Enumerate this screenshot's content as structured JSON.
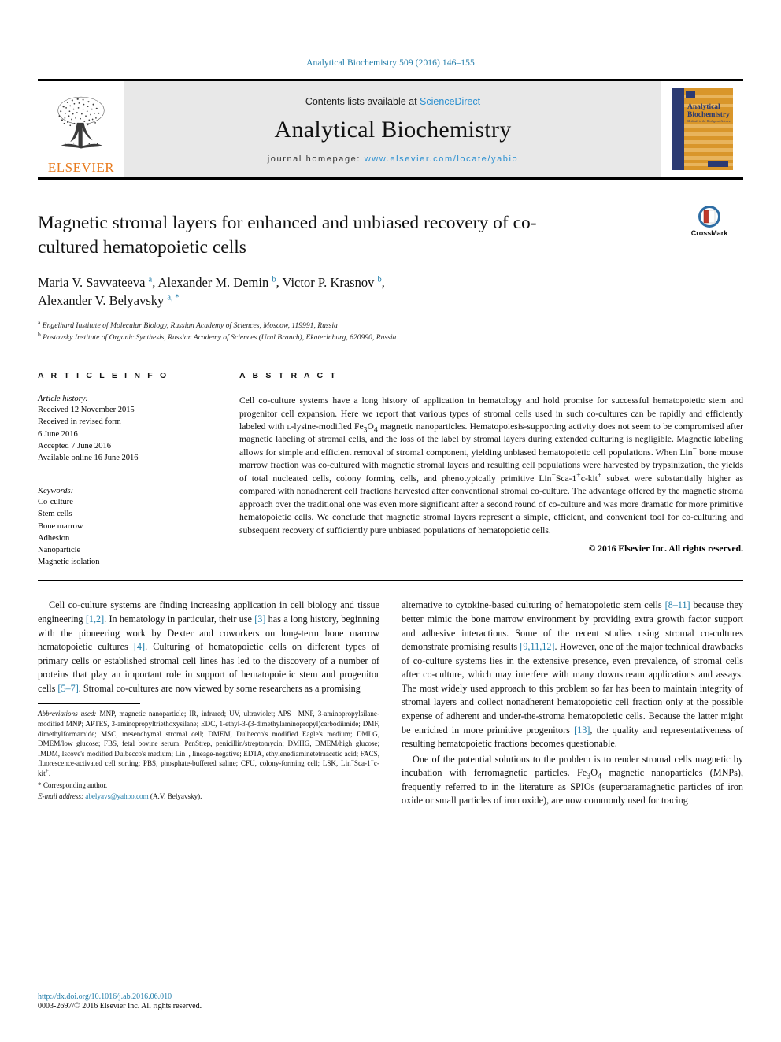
{
  "running_head": "Analytical Biochemistry 509 (2016) 146–155",
  "masthead": {
    "publisher_name": "ELSEVIER",
    "contents_prefix": "Contents lists available at ",
    "contents_link": "ScienceDirect",
    "journal_title": "Analytical Biochemistry",
    "homepage_prefix": "journal homepage: ",
    "homepage_url": "www.elsevier.com/locate/yabio",
    "cover_title_line1": "Analytical",
    "cover_title_line2": "Biochemistry",
    "cover_subtitle": "Methods in the Biological Sciences"
  },
  "crossmark": {
    "label": "CrossMark"
  },
  "article": {
    "title": "Magnetic stromal layers for enhanced and unbiased recovery of co-cultured hematopoietic cells",
    "authors_line1_html": "Maria V. Savvateeva <sup>a</sup>, Alexander M. Demin <sup>b</sup>, Victor P. Krasnov <sup>b</sup>,",
    "authors_line2_html": "Alexander V. Belyavsky <sup>a, *</sup>",
    "affiliation_a": "Engelhard Institute of Molecular Biology, Russian Academy of Sciences, Moscow, 119991, Russia",
    "affiliation_b": "Postovsky Institute of Organic Synthesis, Russian Academy of Sciences (Ural Branch), Ekaterinburg, 620990, Russia"
  },
  "article_info": {
    "heading": "A R T I C L E  I N F O",
    "history_title": "Article history:",
    "history": [
      "Received 12 November 2015",
      "Received in revised form",
      "6 June 2016",
      "Accepted 7 June 2016",
      "Available online 16 June 2016"
    ],
    "keywords_title": "Keywords:",
    "keywords": [
      "Co-culture",
      "Stem cells",
      "Bone marrow",
      "Adhesion",
      "Nanoparticle",
      "Magnetic isolation"
    ]
  },
  "abstract": {
    "heading": "A B S T R A C T",
    "text_html": "Cell co-culture systems have a long history of application in hematology and hold promise for successful hematopoietic stem and progenitor cell expansion. Here we report that various types of stromal cells used in such co-cultures can be rapidly and efficiently labeled with <span style=\"font-variant:small-caps\">l</span>-lysine-modified Fe<sub>3</sub>O<sub>4</sub> magnetic nanoparticles. Hematopoiesis-supporting activity does not seem to be compromised after magnetic labeling of stromal cells, and the loss of the label by stromal layers during extended culturing is negligible. Magnetic labeling allows for simple and efficient removal of stromal component, yielding unbiased hematopoietic cell populations. When Lin<sup>&minus;</sup> bone mouse marrow fraction was co-cultured with magnetic stromal layers and resulting cell populations were harvested by trypsinization, the yields of total nucleated cells, colony forming cells, and phenotypically primitive Lin<sup>&minus;</sup>Sca-1<sup>+</sup>c-kit<sup>+</sup> subset were substantially higher as compared with nonadherent cell fractions harvested after conventional stromal co-culture. The advantage offered by the magnetic stroma approach over the traditional one was even more significant after a second round of co-culture and was more dramatic for more primitive hematopoietic cells. We conclude that magnetic stromal layers represent a simple, efficient, and convenient tool for co-culturing and subsequent recovery of sufficiently pure unbiased populations of hematopoietic cells.",
    "copyright": "© 2016 Elsevier Inc. All rights reserved."
  },
  "body": {
    "left_paragraphs_html": [
      "Cell co-culture systems are finding increasing application in cell biology and tissue engineering <span class=\"cit\">[1,2]</span>. In hematology in particular, their use <span class=\"cit\">[3]</span> has a long history, beginning with the pioneering work by Dexter and coworkers on long-term bone marrow hematopoietic cultures <span class=\"cit\">[4]</span>. Culturing of hematopoietic cells on different types of primary cells or established stromal cell lines has led to the discovery of a number of proteins that play an important role in support of hematopoietic stem and progenitor cells <span class=\"cit\">[5&ndash;7]</span>. Stromal co-cultures are now viewed by some researchers as a promising"
    ],
    "right_paragraphs_html": [
      "alternative to cytokine-based culturing of hematopoietic stem cells <span class=\"cit\">[8&ndash;11]</span> because they better mimic the bone marrow environment by providing extra growth factor support and adhesive interactions. Some of the recent studies using stromal co-cultures demonstrate promising results <span class=\"cit\">[9,11,12]</span>. However, one of the major technical drawbacks of co-culture systems lies in the extensive presence, even prevalence, of stromal cells after co-culture, which may interfere with many downstream applications and assays. The most widely used approach to this problem so far has been to maintain integrity of stromal layers and collect nonadherent hematopoietic cell fraction only at the possible expense of adherent and under-the-stroma hematopoietic cells. Because the latter might be enriched in more primitive progenitors <span class=\"cit\">[13]</span>, the quality and representativeness of resulting hematopoietic fractions becomes questionable.",
      "One of the potential solutions to the problem is to render stromal cells magnetic by incubation with ferromagnetic particles. Fe<sub>3</sub>O<sub>4</sub> magnetic nanoparticles (MNPs), frequently referred to in the literature as SPIOs (superparamagnetic particles of iron oxide or small particles of iron oxide), are now commonly used for tracing"
    ]
  },
  "footnotes": {
    "abbreviations_html": "<i>Abbreviations used:</i> MNP, magnetic nanoparticle; IR, infrared; UV, ultraviolet; APS&mdash;MNP, 3-aminopropylsilane-modified MNP; APTES, 3-aminopropyltriethoxysilane; EDC, 1-ethyl-3-(3-dimethylaminopropyl)carbodiimide; DMF, dimethylformamide; MSC, mesenchymal stromal cell; DMEM, Dulbecco's modified Eagle's medium; DMLG, DMEM/low glucose; FBS, fetal bovine serum; PenStrep, penicillin/streptomycin; DMHG, DMEM/high glucose; IMDM, Iscove's modified Dulbecco's medium; Lin<sup>&minus;</sup>, lineage-negative; EDTA, ethylenediaminetetraacetic acid; FACS, fluorescence-activated cell sorting; PBS, phosphate-buffered saline; CFU, colony-forming cell; LSK, Lin<sup>&minus;</sup>Sca-1<sup>+</sup>c-kit<sup>+</sup>.",
    "corresponding": "* Corresponding author.",
    "email_label": "E-mail address:",
    "email": "abelyavs@yahoo.com",
    "email_suffix": "(A.V. Belyavsky)."
  },
  "footer": {
    "doi": "http://dx.doi.org/10.1016/j.ab.2016.06.010",
    "issn_line": "0003-2697/© 2016 Elsevier Inc. All rights reserved."
  },
  "colors": {
    "link_blue": "#1f7ba8",
    "sciencedirect_blue": "#2a8fd0",
    "elsevier_orange": "#e87b1e",
    "cover_navy": "#2b3a72",
    "cover_orange": "#d9962a"
  }
}
